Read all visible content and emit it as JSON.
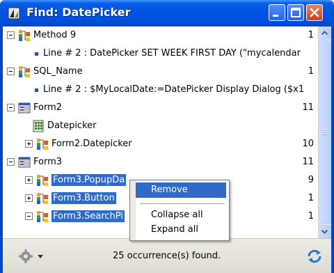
{
  "window": {
    "title": "Find: DatePicker"
  },
  "tree": {
    "rows": [
      {
        "label": "Method 9",
        "count": "1",
        "icon": "method-icon",
        "type": "node",
        "expanded": true
      },
      {
        "label": "Line # 2 : DatePicker SET WEEK FIRST DAY (\"mycalendar",
        "count": "",
        "icon": "bullet-icon",
        "type": "leaf"
      },
      {
        "label": "SQL_Name",
        "count": "1",
        "icon": "method-icon",
        "type": "node",
        "expanded": true
      },
      {
        "label": "Line # 2 : $MyLocalDate:=DatePicker Display Dialog ($x1",
        "count": "",
        "icon": "bullet-icon",
        "type": "leaf"
      },
      {
        "label": "Form2",
        "count": "11",
        "icon": "form-icon",
        "type": "node",
        "expanded": true
      },
      {
        "label": "Datepicker",
        "count": "",
        "icon": "calendar-icon",
        "type": "leaf"
      },
      {
        "label": "Form2.Datepicker",
        "count": "10",
        "icon": "method-icon",
        "type": "node",
        "expanded": false
      },
      {
        "label": "Form3",
        "count": "11",
        "icon": "form-icon",
        "type": "node",
        "expanded": true
      },
      {
        "label": "Form3.PopupDa",
        "count": "9",
        "icon": "method-icon",
        "type": "node",
        "expanded": false,
        "selected": true
      },
      {
        "label": "Form3.Button",
        "count": "1",
        "icon": "method-icon",
        "type": "node",
        "expanded": false,
        "selected": true
      },
      {
        "label": "Form3.SearchPi",
        "count": "1",
        "icon": "method-icon",
        "type": "node",
        "expanded": true,
        "selected": true
      }
    ]
  },
  "context_menu": {
    "items": [
      "Remove",
      "Collapse all",
      "Expand all"
    ],
    "highlighted": "Remove"
  },
  "footer": {
    "status": "25 occurrence(s) found."
  },
  "colors": {
    "titlebar": "#0054e3",
    "selection": "#3169c6",
    "close_button": "#c9421b"
  }
}
